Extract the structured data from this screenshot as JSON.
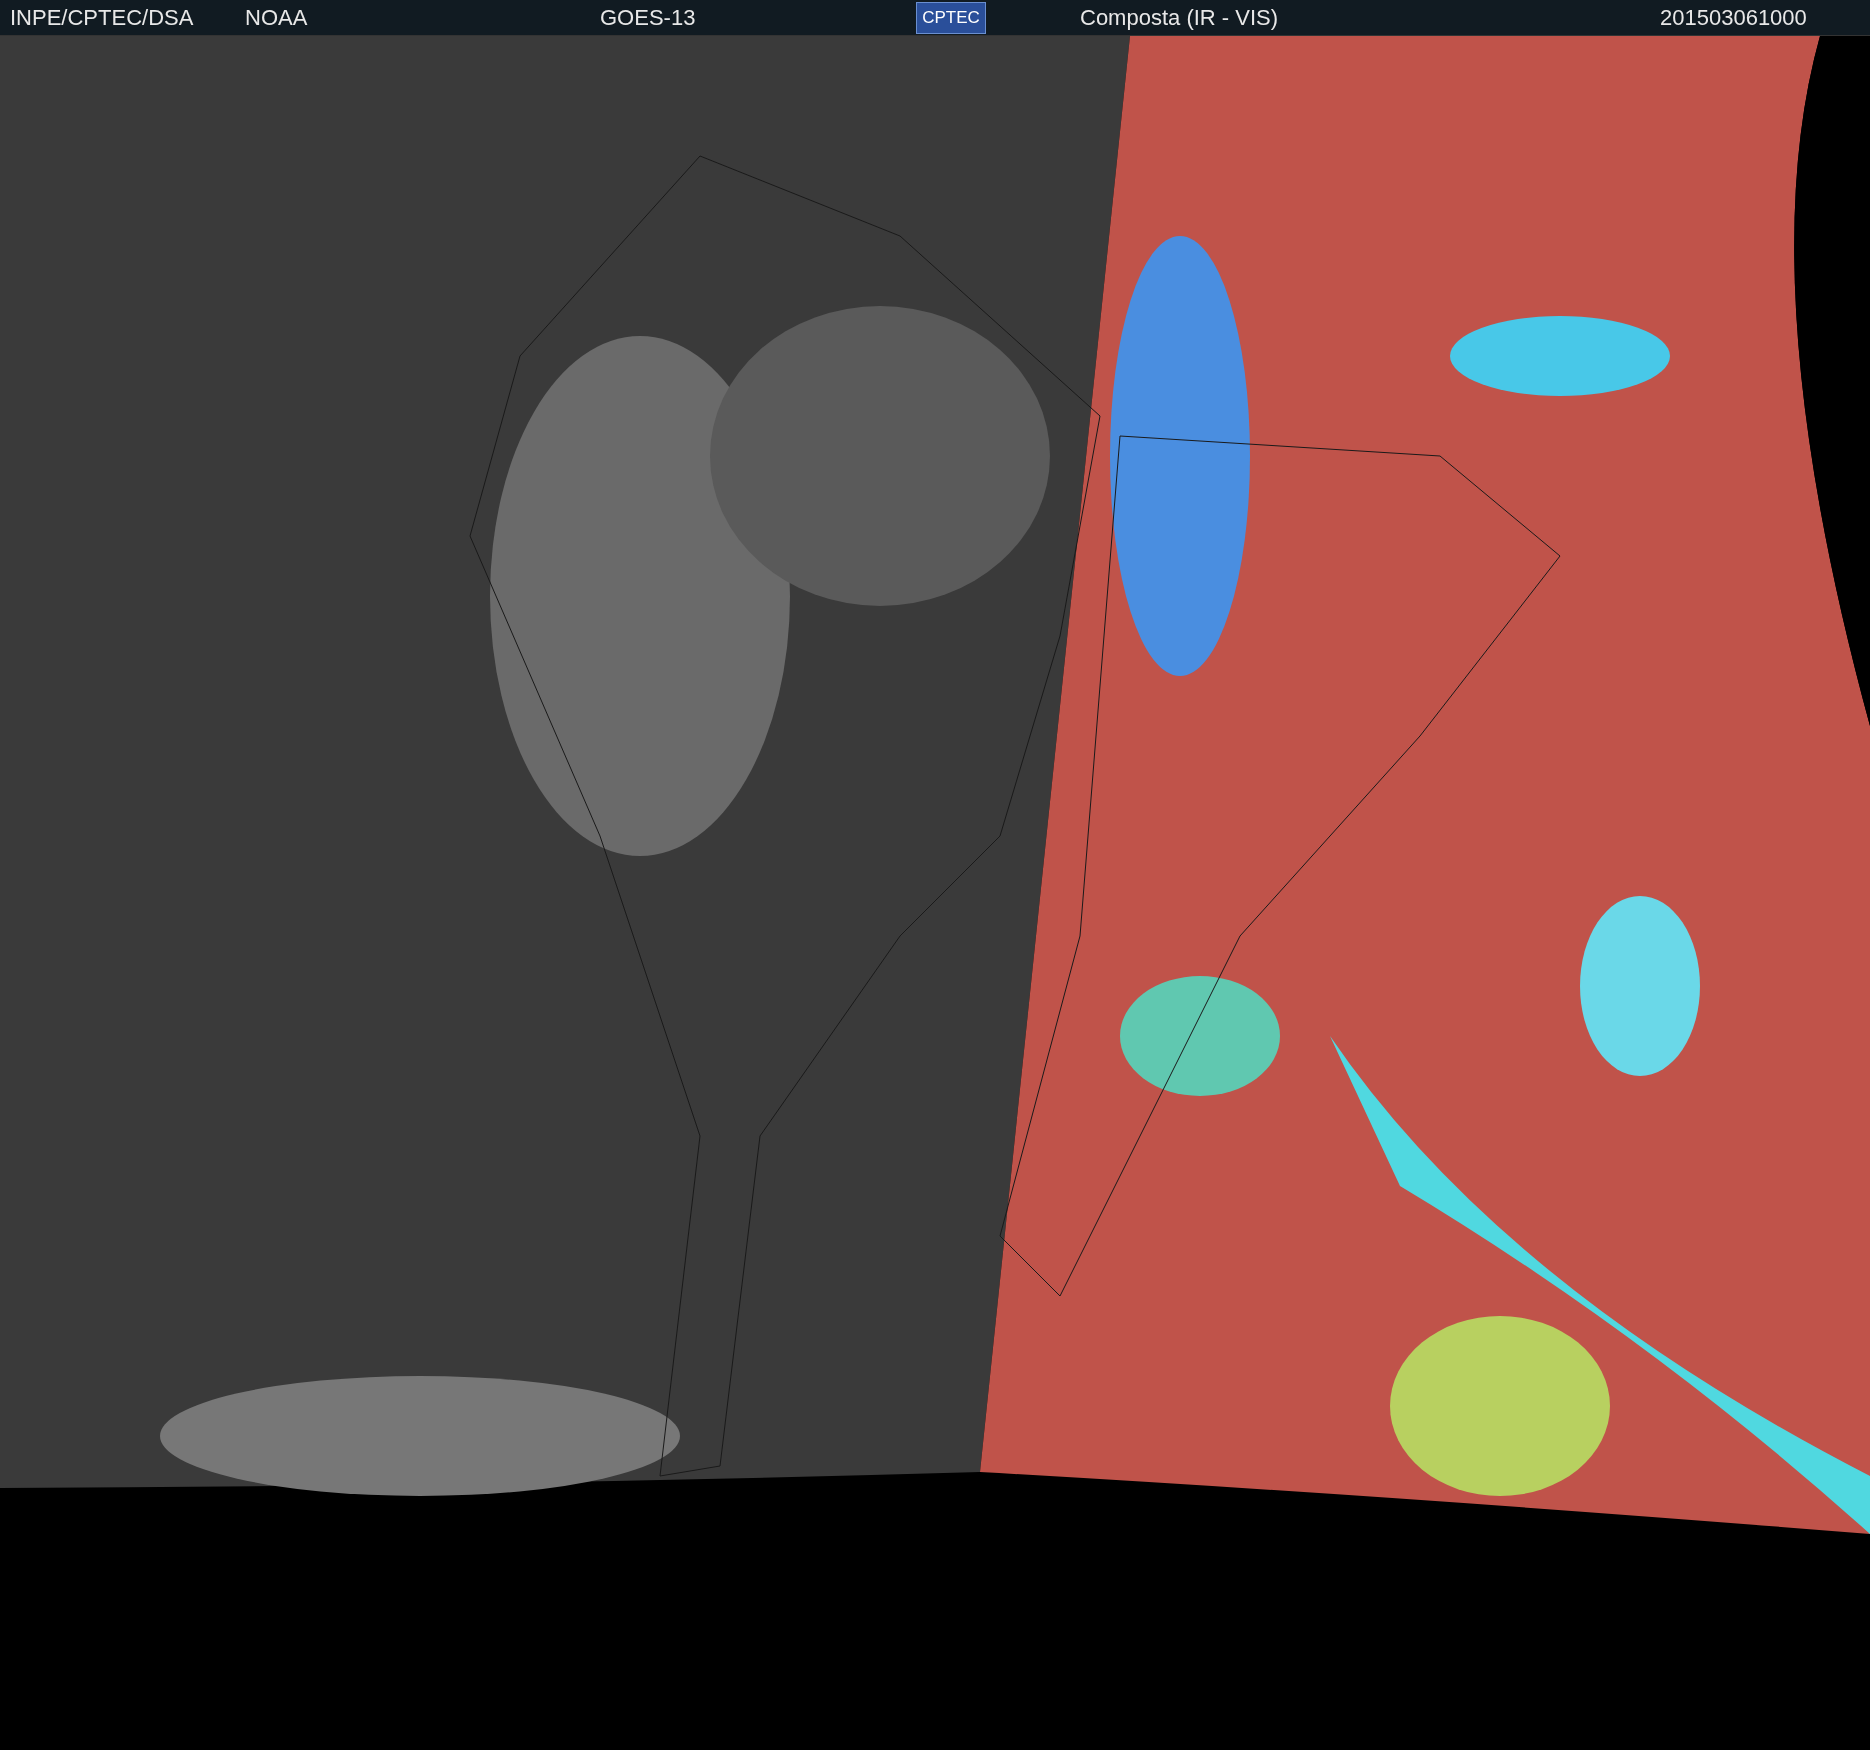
{
  "header": {
    "source": "INPE/CPTEC/DSA",
    "agency": "NOAA",
    "satellite": "GOES-13",
    "logo": "CPTEC",
    "product": "Composta (IR - VIS)",
    "timestamp": "201503061000"
  }
}
